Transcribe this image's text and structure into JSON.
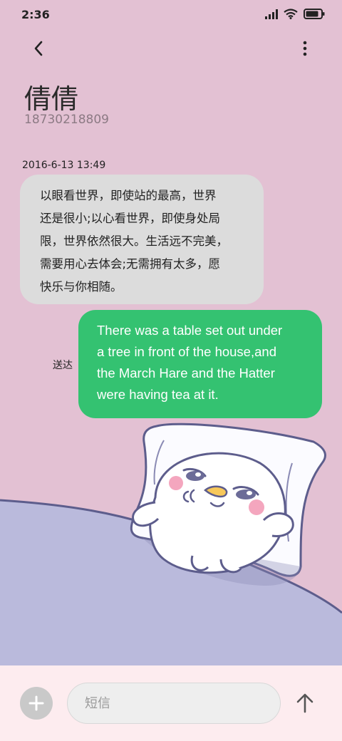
{
  "status_bar": {
    "time": "2:36",
    "battery_level": 0.85
  },
  "header": {
    "back_icon": "chevron-left-icon",
    "more_icon": "more-vertical-icon",
    "contact_name": "倩倩",
    "contact_number": "18730218809"
  },
  "messages": [
    {
      "direction": "incoming",
      "timestamp": "2016-6-13 13:49",
      "text": "以眼看世界，即使站的最高，世界\n还是很小;以心看世界，即使身处局\n限，世界依然很大。生活远不完美，\n需要用心去体会;无需拥有太多，愿\n快乐与你相随。"
    },
    {
      "direction": "outgoing",
      "status": "送达",
      "text": "There was a table set out under\na tree in front of the house,and\nthe March Hare and the Hatter\nwere having tea at it."
    }
  ],
  "composer": {
    "placeholder": "短信",
    "add_icon": "plus-icon",
    "send_icon": "arrow-up-icon"
  },
  "colors": {
    "background_pink": "#e3c1d3",
    "background_lavender": "#babadc",
    "incoming_bubble": "#dcdcdc",
    "outgoing_bubble": "#34c271",
    "bottom_bar": "#fdecef"
  }
}
